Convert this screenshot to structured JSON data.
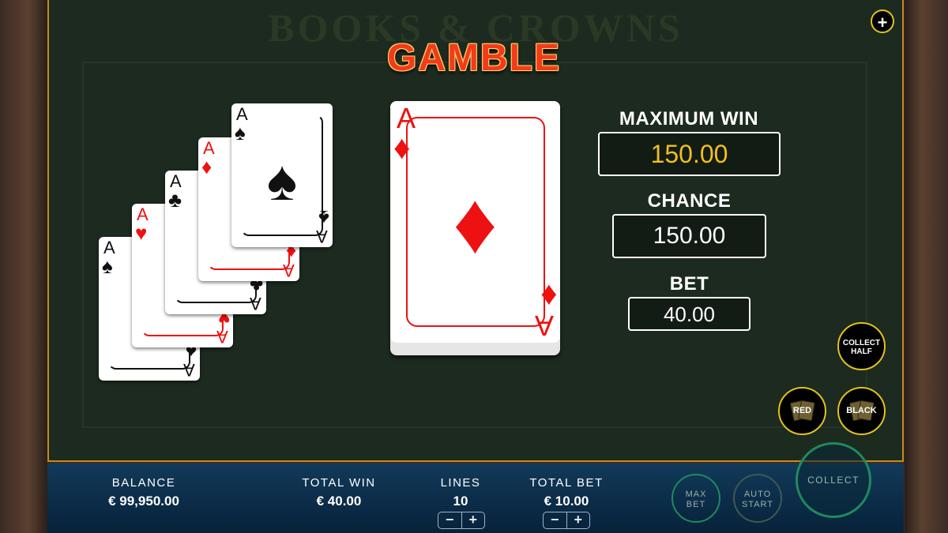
{
  "background": {
    "logo_text": "BOOKS & CROWNS"
  },
  "title": "GAMBLE",
  "plus_button": {
    "label": "+"
  },
  "history_cards": [
    {
      "rank": "A",
      "suit": "♠",
      "color": "black"
    },
    {
      "rank": "A",
      "suit": "♥",
      "color": "red"
    },
    {
      "rank": "A",
      "suit": "♣",
      "color": "black"
    },
    {
      "rank": "A",
      "suit": "♦",
      "color": "red"
    },
    {
      "rank": "A",
      "suit": "♠",
      "color": "black"
    }
  ],
  "current_card": {
    "rank": "A",
    "suit": "♦",
    "color": "red"
  },
  "info": {
    "max_win_label": "MAXIMUM WIN",
    "max_win_value": "150.00",
    "chance_label": "CHANCE",
    "chance_value": "150.00",
    "bet_label": "BET",
    "bet_value": "40.00"
  },
  "actions": {
    "collect_half_line1": "COLLECT",
    "collect_half_line2": "HALF",
    "red_label": "RED",
    "black_label": "BLACK"
  },
  "bottom_bar": {
    "balance_label": "BALANCE",
    "balance_value": "€ 99,950.00",
    "total_win_label": "TOTAL WIN",
    "total_win_value": "€ 40.00",
    "lines_label": "LINES",
    "lines_value": "10",
    "total_bet_label": "TOTAL BET",
    "total_bet_value": "€ 10.00",
    "stepper_minus": "−",
    "stepper_plus": "+",
    "max_bet_line1": "MAX",
    "max_bet_line2": "BET",
    "auto_start_line1": "AUTO",
    "auto_start_line2": "START",
    "collect_label": "COLLECT"
  },
  "colors": {
    "accent_gold": "#e2c21c",
    "max_win_value": "#f2c01a",
    "title_red": "#f33b1b",
    "card_red": "#e11111",
    "bottom_bar": "#0b2b47",
    "frame_border": "#c58a1e"
  }
}
